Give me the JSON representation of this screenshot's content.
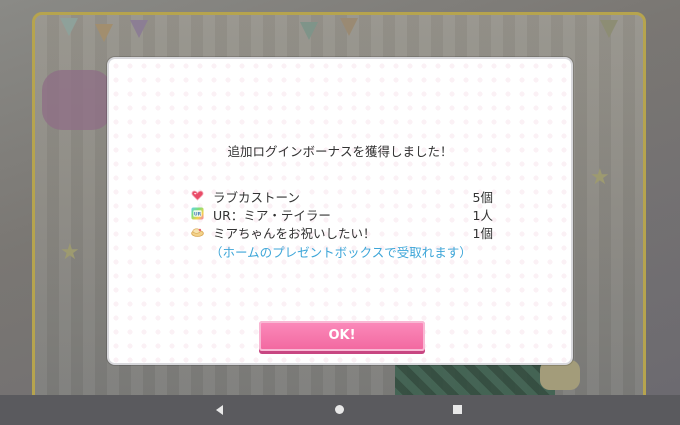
{
  "dialog": {
    "title": "追加ログインボーナスを獲得しました！",
    "rewards": [
      {
        "icon": "heart-stone-icon",
        "name": "ラブカストーン",
        "qty": "5個"
      },
      {
        "icon": "ur-card-icon",
        "name": "UR：ミア・テイラー",
        "qty": "1人"
      },
      {
        "icon": "food-item-icon",
        "name": "ミアちゃんをお祝いしたい！",
        "qty": "1個"
      }
    ],
    "note": "（ホームのプレゼントボックスで受取れます）",
    "ok_label": "OK!"
  },
  "colors": {
    "note": "#3ea6d8",
    "ok_button": "#f2679f",
    "heart": "#e94b67"
  },
  "navbar": {
    "icons": [
      "back-icon",
      "home-icon",
      "recents-icon"
    ]
  }
}
